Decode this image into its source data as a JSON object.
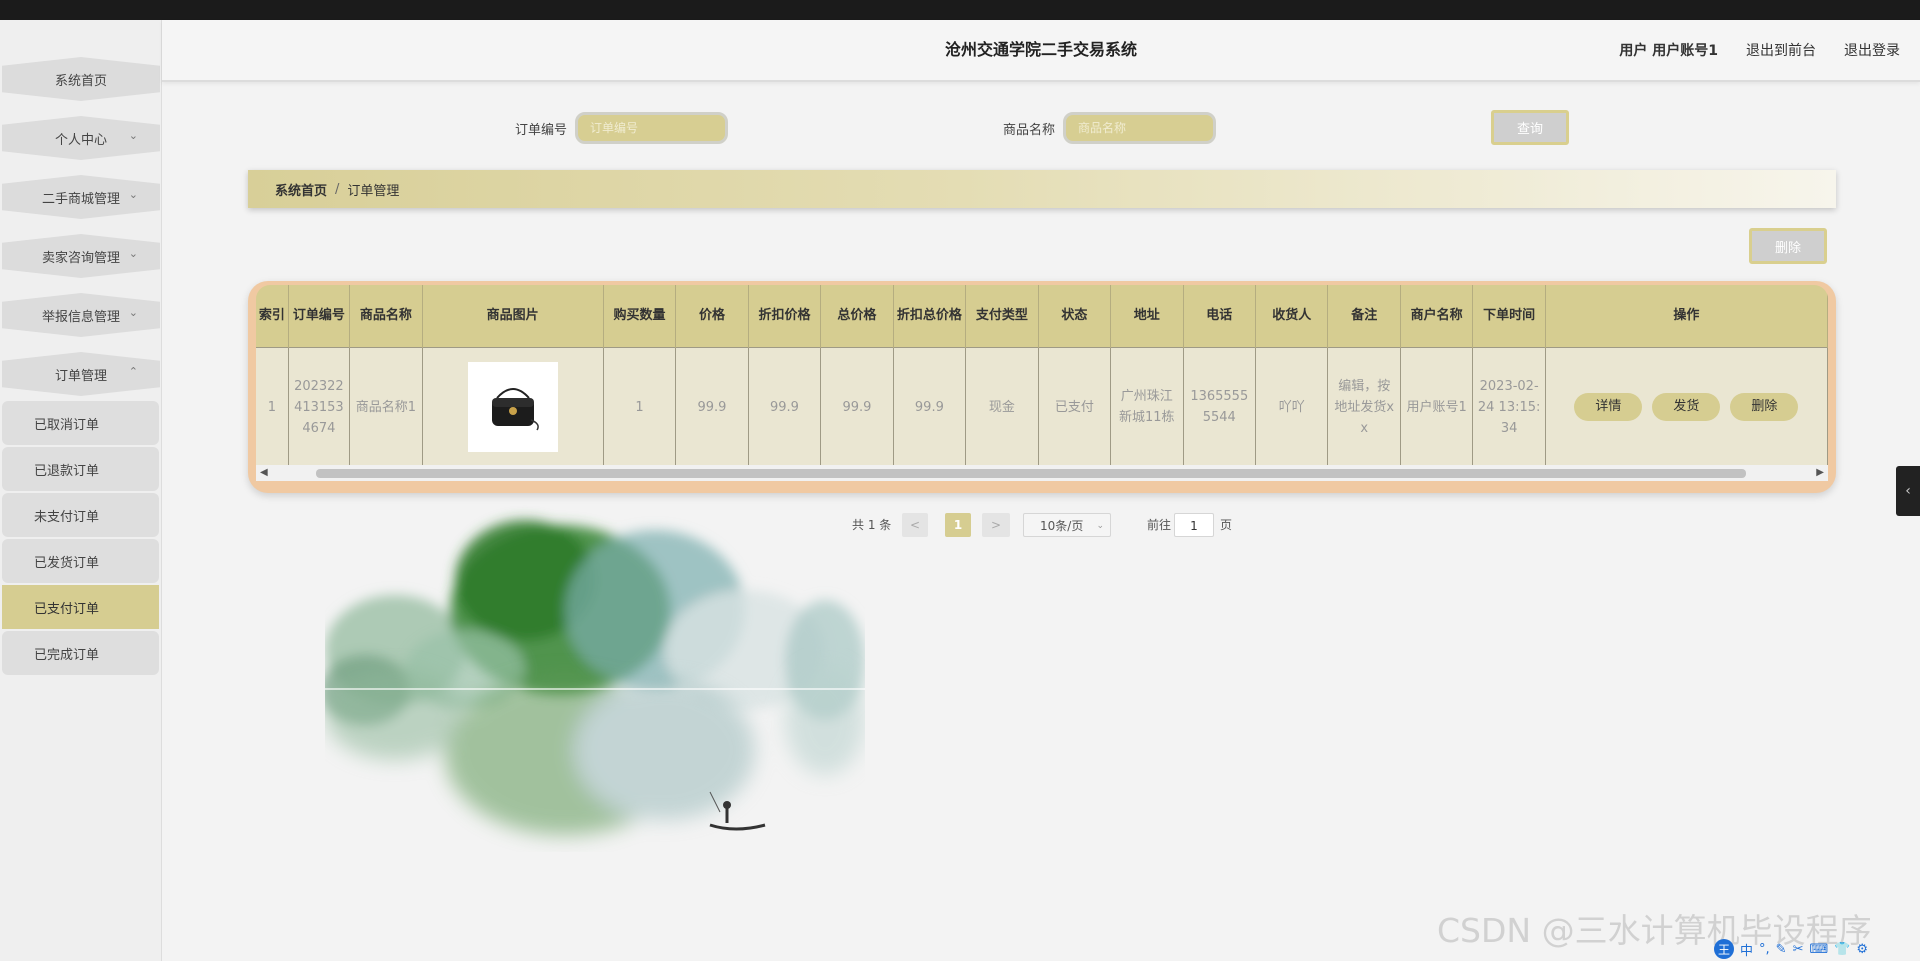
{
  "app": {
    "title": "沧州交通学院二手交易系统"
  },
  "header": {
    "user_text": "用户 用户账号1",
    "front_link": "退出到前台",
    "logout_link": "退出登录"
  },
  "sidebar": {
    "items": [
      {
        "label": "系统首页"
      },
      {
        "label": "个人中心",
        "chevron": "⌄"
      },
      {
        "label": "二手商城管理",
        "chevron": "⌄"
      },
      {
        "label": "卖家咨询管理",
        "chevron": "⌄"
      },
      {
        "label": "举报信息管理",
        "chevron": "⌄"
      },
      {
        "label": "订单管理",
        "chevron": "⌃"
      }
    ],
    "sub_items": [
      {
        "label": "已取消订单"
      },
      {
        "label": "已退款订单"
      },
      {
        "label": "未支付订单"
      },
      {
        "label": "已发货订单"
      },
      {
        "label": "已支付订单"
      },
      {
        "label": "已完成订单"
      }
    ]
  },
  "search": {
    "order_no_label": "订单编号",
    "order_no_placeholder": "订单编号",
    "product_label": "商品名称",
    "product_placeholder": "商品名称",
    "query_label": "查询"
  },
  "breadcrumb": {
    "home": "系统首页",
    "sep": "/",
    "current": "订单管理"
  },
  "toolbar": {
    "delete_label": "删除"
  },
  "table": {
    "headers": [
      "索引",
      "订单编号",
      "商品名称",
      "商品图片",
      "购买数量",
      "价格",
      "折扣价格",
      "总价格",
      "折扣总价格",
      "支付类型",
      "状态",
      "地址",
      "电话",
      "收货人",
      "备注",
      "商户名称",
      "下单时间",
      "操作"
    ],
    "row": {
      "index": "1",
      "order_no": "2023224131534674",
      "product_name": "商品名称1",
      "quantity": "1",
      "price": "99.9",
      "discount_price": "99.9",
      "total_price": "99.9",
      "discount_total": "99.9",
      "pay_type": "现金",
      "status": "已支付",
      "address": "广州珠江新城11栋",
      "phone": "13655555544",
      "receiver": "吖吖",
      "remark": "编辑，按地址发货xx",
      "merchant": "用户账号1",
      "order_time": "2023-02-24 13:15:34",
      "actions": [
        "详情",
        "发货",
        "删除"
      ]
    }
  },
  "pagination": {
    "total": "共 1 条",
    "prev": "<",
    "page": "1",
    "next": ">",
    "page_size": "10条/页",
    "goto_label": "前往",
    "goto_value": "1",
    "page_suffix": "页"
  },
  "watermark": "CSDN @三水计算机毕设程序",
  "ime_bar": [
    "王",
    "中",
    "°,",
    "✎",
    "✂",
    "⌨",
    "👕",
    "⚙"
  ],
  "colors": {
    "accent": "#d6cd91",
    "border_orange": "#f0c9a2",
    "sidebar_active": "#d6cd91"
  }
}
